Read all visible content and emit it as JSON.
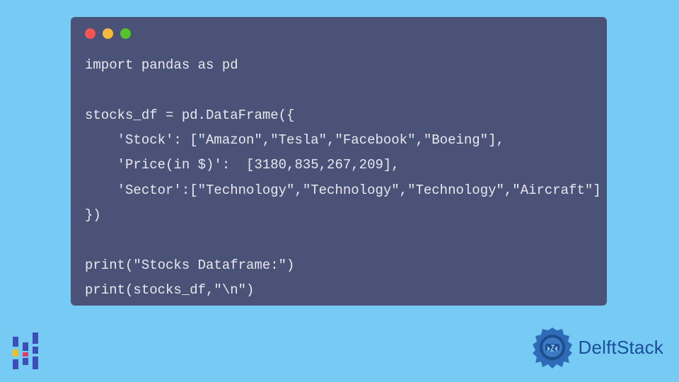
{
  "code": {
    "lines": [
      "import pandas as pd",
      "",
      "stocks_df = pd.DataFrame({",
      "    'Stock': [\"Amazon\",\"Tesla\",\"Facebook\",\"Boeing\"],",
      "    'Price(in $)':  [3180,835,267,209],",
      "    'Sector':[\"Technology\",\"Technology\",\"Technology\",\"Aircraft\"]",
      "})",
      "",
      "print(\"Stocks Dataframe:\")",
      "print(stocks_df,\"\\n\")"
    ]
  },
  "brand": {
    "name": "DelftStack"
  }
}
